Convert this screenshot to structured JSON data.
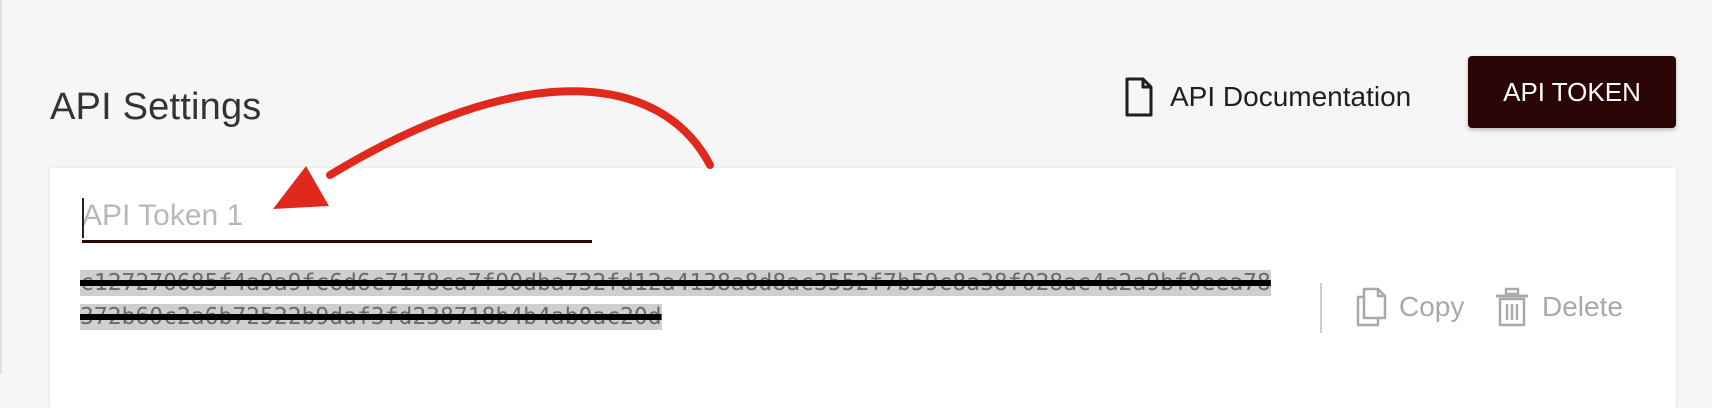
{
  "page": {
    "title": "API Settings"
  },
  "header": {
    "docs_link_label": "API Documentation",
    "docs_icon": "document-icon",
    "token_button_label": "API TOKEN"
  },
  "token_card": {
    "name_placeholder": "API Token 1",
    "token_value": "c127270685f4a9a9fc6d6c7178ca7f90dba732fd12a4138a8d8ac3552f7b59c8a38f028ac4a2a9bf0eea78372b60c2a6b72522b9daf3fd238718b4b4ab0ac20d",
    "copy_label": "Copy",
    "copy_icon": "copy-icon",
    "delete_label": "Delete",
    "delete_icon": "trash-icon"
  },
  "annotation": {
    "arrow_color": "#e0281c"
  },
  "colors": {
    "accent": "#2a0505",
    "background": "#f6f6f6",
    "card": "#ffffff",
    "muted_action": "#a9a9a9"
  }
}
